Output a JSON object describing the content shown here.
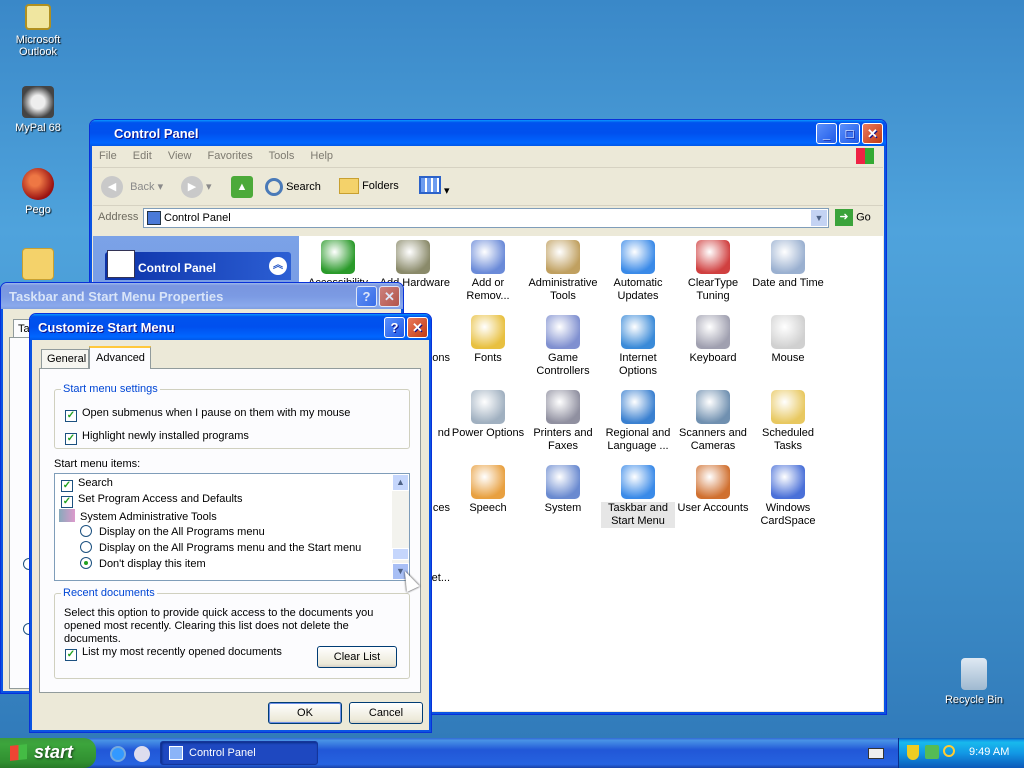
{
  "desktop": {
    "icons": [
      {
        "label": "Microsoft Outlook"
      },
      {
        "label": "MyPal 68"
      },
      {
        "label": "Pego"
      },
      {
        "label": "Recycle Bin"
      }
    ]
  },
  "control_panel": {
    "title": "Control Panel",
    "menu": [
      "File",
      "Edit",
      "View",
      "Favorites",
      "Tools",
      "Help"
    ],
    "toolbar": {
      "back": "Back",
      "search": "Search",
      "folders": "Folders"
    },
    "address_label": "Address",
    "address_value": "Control Panel",
    "go": "Go",
    "task_pane_title": "Control Panel",
    "items": [
      {
        "label": "Accessibility"
      },
      {
        "label": "Add Hardware"
      },
      {
        "label": "Add or Remov..."
      },
      {
        "label": "Administrative Tools"
      },
      {
        "label": "Automatic Updates"
      },
      {
        "label": "ClearType Tuning"
      },
      {
        "label": "Date and Time"
      },
      {
        "label": "ons"
      },
      {
        "label": "Fonts"
      },
      {
        "label": "Game Controllers"
      },
      {
        "label": "Internet Options"
      },
      {
        "label": "Keyboard"
      },
      {
        "label": "Mouse"
      },
      {
        "label": "nd"
      },
      {
        "label": "Power Options"
      },
      {
        "label": "Printers and Faxes"
      },
      {
        "label": "Regional and Language ..."
      },
      {
        "label": "Scanners and Cameras"
      },
      {
        "label": "Scheduled Tasks"
      },
      {
        "label": "nd ces"
      },
      {
        "label": "Speech"
      },
      {
        "label": "System"
      },
      {
        "label": "Taskbar and Start Menu"
      },
      {
        "label": "User Accounts"
      },
      {
        "label": "Windows CardSpace"
      },
      {
        "label": "et..."
      }
    ]
  },
  "taskbar_props": {
    "title": "Taskbar and Start Menu Properties",
    "tab_fragment": "Ta"
  },
  "customize": {
    "title": "Customize Start Menu",
    "tabs": [
      "General",
      "Advanced"
    ],
    "settings_group": "Start menu settings",
    "settings": [
      {
        "label": "Open submenus when I pause on them with my mouse",
        "checked": true
      },
      {
        "label": "Highlight newly installed programs",
        "checked": true
      }
    ],
    "items_label": "Start menu items:",
    "items": [
      {
        "label": "Search"
      },
      {
        "label": "Set Program Access and Defaults"
      },
      {
        "label": "System Administrative Tools"
      },
      {
        "label": "Display on the All Programs menu"
      },
      {
        "label": "Display on the All Programs menu and the Start menu"
      },
      {
        "label": "Don't display this item"
      }
    ],
    "recent_group": "Recent documents",
    "recent_desc": "Select this option to provide quick access to the documents you opened most recently.  Clearing this list does not delete the documents.",
    "recent_check": "List my most recently opened documents",
    "clear_list": "Clear List",
    "ok": "OK",
    "cancel": "Cancel"
  },
  "taskbar": {
    "start": "start",
    "task": "Control Panel",
    "clock": "9:49 AM"
  },
  "colors": {
    "accent": "#0a54e3",
    "start_green": "#3ca53c",
    "tray": "#139ee9"
  }
}
